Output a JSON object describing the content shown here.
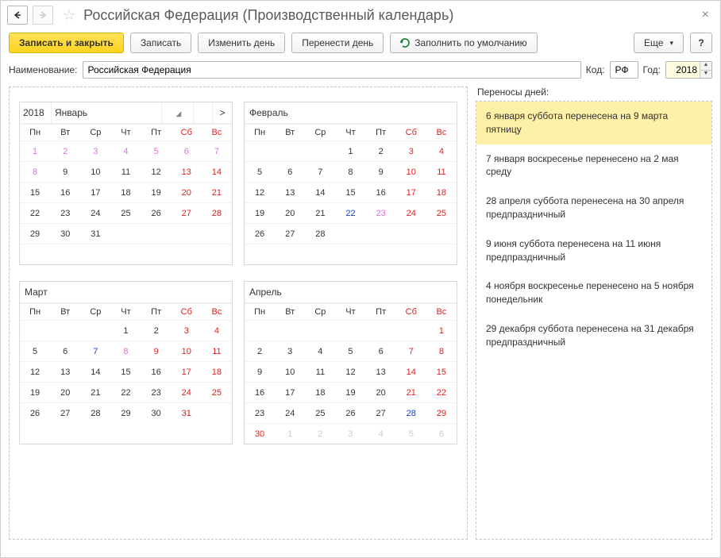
{
  "title": "Российская Федерация (Производственный календарь)",
  "toolbar": {
    "save_close": "Записать и закрыть",
    "save": "Записать",
    "change_day": "Изменить день",
    "move_day": "Перенести день",
    "fill_default": "Заполнить по умолчанию",
    "more": "Еще",
    "help": "?"
  },
  "form": {
    "name_label": "Наименование:",
    "name_value": "Российская Федерация",
    "code_label": "Код:",
    "code_value": "РФ",
    "year_label": "Год:",
    "year_value": "2018"
  },
  "cal": {
    "year": "2018",
    "dow": [
      "Пн",
      "Вт",
      "Ср",
      "Чт",
      "Пт",
      "Сб",
      "Вс"
    ],
    "months": [
      {
        "name": "Январь",
        "show_year": true,
        "show_nav": true,
        "weeks": [
          [
            {
              "d": "1",
              "c": "holiday"
            },
            {
              "d": "2",
              "c": "holiday"
            },
            {
              "d": "3",
              "c": "holiday"
            },
            {
              "d": "4",
              "c": "holiday"
            },
            {
              "d": "5",
              "c": "holiday"
            },
            {
              "d": "6",
              "c": "holiday"
            },
            {
              "d": "7",
              "c": "holiday"
            }
          ],
          [
            {
              "d": "8",
              "c": "holiday"
            },
            {
              "d": "9"
            },
            {
              "d": "10"
            },
            {
              "d": "11"
            },
            {
              "d": "12"
            },
            {
              "d": "13",
              "c": "weekend"
            },
            {
              "d": "14",
              "c": "weekend"
            }
          ],
          [
            {
              "d": "15"
            },
            {
              "d": "16"
            },
            {
              "d": "17"
            },
            {
              "d": "18"
            },
            {
              "d": "19"
            },
            {
              "d": "20",
              "c": "weekend"
            },
            {
              "d": "21",
              "c": "weekend"
            }
          ],
          [
            {
              "d": "22"
            },
            {
              "d": "23"
            },
            {
              "d": "24"
            },
            {
              "d": "25"
            },
            {
              "d": "26"
            },
            {
              "d": "27",
              "c": "weekend"
            },
            {
              "d": "28",
              "c": "weekend"
            }
          ],
          [
            {
              "d": "29"
            },
            {
              "d": "30"
            },
            {
              "d": "31"
            },
            {
              "d": ""
            },
            {
              "d": ""
            },
            {
              "d": ""
            },
            {
              "d": ""
            }
          ],
          [
            {
              "d": ""
            },
            {
              "d": ""
            },
            {
              "d": ""
            },
            {
              "d": ""
            },
            {
              "d": ""
            },
            {
              "d": ""
            },
            {
              "d": ""
            }
          ]
        ]
      },
      {
        "name": "Февраль",
        "weeks": [
          [
            {
              "d": ""
            },
            {
              "d": ""
            },
            {
              "d": ""
            },
            {
              "d": "1"
            },
            {
              "d": "2"
            },
            {
              "d": "3",
              "c": "weekend"
            },
            {
              "d": "4",
              "c": "weekend"
            }
          ],
          [
            {
              "d": "5"
            },
            {
              "d": "6"
            },
            {
              "d": "7"
            },
            {
              "d": "8"
            },
            {
              "d": "9"
            },
            {
              "d": "10",
              "c": "weekend"
            },
            {
              "d": "11",
              "c": "weekend"
            }
          ],
          [
            {
              "d": "12"
            },
            {
              "d": "13"
            },
            {
              "d": "14"
            },
            {
              "d": "15"
            },
            {
              "d": "16"
            },
            {
              "d": "17",
              "c": "weekend"
            },
            {
              "d": "18",
              "c": "weekend"
            }
          ],
          [
            {
              "d": "19"
            },
            {
              "d": "20"
            },
            {
              "d": "21"
            },
            {
              "d": "22",
              "c": "preholiday"
            },
            {
              "d": "23",
              "c": "holiday"
            },
            {
              "d": "24",
              "c": "weekend"
            },
            {
              "d": "25",
              "c": "weekend"
            }
          ],
          [
            {
              "d": "26"
            },
            {
              "d": "27"
            },
            {
              "d": "28"
            },
            {
              "d": ""
            },
            {
              "d": ""
            },
            {
              "d": ""
            },
            {
              "d": ""
            }
          ],
          [
            {
              "d": ""
            },
            {
              "d": ""
            },
            {
              "d": ""
            },
            {
              "d": ""
            },
            {
              "d": ""
            },
            {
              "d": ""
            },
            {
              "d": ""
            }
          ]
        ]
      },
      {
        "name": "Март",
        "weeks": [
          [
            {
              "d": ""
            },
            {
              "d": ""
            },
            {
              "d": ""
            },
            {
              "d": "1"
            },
            {
              "d": "2"
            },
            {
              "d": "3",
              "c": "weekend"
            },
            {
              "d": "4",
              "c": "weekend"
            }
          ],
          [
            {
              "d": "5"
            },
            {
              "d": "6"
            },
            {
              "d": "7",
              "c": "preholiday"
            },
            {
              "d": "8",
              "c": "holiday"
            },
            {
              "d": "9",
              "c": "weekend"
            },
            {
              "d": "10",
              "c": "weekend"
            },
            {
              "d": "11",
              "c": "weekend"
            }
          ],
          [
            {
              "d": "12"
            },
            {
              "d": "13"
            },
            {
              "d": "14"
            },
            {
              "d": "15"
            },
            {
              "d": "16"
            },
            {
              "d": "17",
              "c": "weekend"
            },
            {
              "d": "18",
              "c": "weekend"
            }
          ],
          [
            {
              "d": "19"
            },
            {
              "d": "20"
            },
            {
              "d": "21"
            },
            {
              "d": "22"
            },
            {
              "d": "23"
            },
            {
              "d": "24",
              "c": "weekend"
            },
            {
              "d": "25",
              "c": "weekend"
            }
          ],
          [
            {
              "d": "26"
            },
            {
              "d": "27"
            },
            {
              "d": "28"
            },
            {
              "d": "29"
            },
            {
              "d": "30"
            },
            {
              "d": "31",
              "c": "weekend"
            },
            {
              "d": ""
            }
          ]
        ]
      },
      {
        "name": "Апрель",
        "weeks": [
          [
            {
              "d": ""
            },
            {
              "d": ""
            },
            {
              "d": ""
            },
            {
              "d": ""
            },
            {
              "d": ""
            },
            {
              "d": ""
            },
            {
              "d": "1",
              "c": "weekend"
            }
          ],
          [
            {
              "d": "2"
            },
            {
              "d": "3"
            },
            {
              "d": "4"
            },
            {
              "d": "5"
            },
            {
              "d": "6"
            },
            {
              "d": "7",
              "c": "weekend"
            },
            {
              "d": "8",
              "c": "weekend"
            }
          ],
          [
            {
              "d": "9"
            },
            {
              "d": "10"
            },
            {
              "d": "11"
            },
            {
              "d": "12"
            },
            {
              "d": "13"
            },
            {
              "d": "14",
              "c": "weekend"
            },
            {
              "d": "15",
              "c": "weekend"
            }
          ],
          [
            {
              "d": "16"
            },
            {
              "d": "17"
            },
            {
              "d": "18"
            },
            {
              "d": "19"
            },
            {
              "d": "20"
            },
            {
              "d": "21",
              "c": "weekend"
            },
            {
              "d": "22",
              "c": "weekend"
            }
          ],
          [
            {
              "d": "23"
            },
            {
              "d": "24"
            },
            {
              "d": "25"
            },
            {
              "d": "26"
            },
            {
              "d": "27"
            },
            {
              "d": "28",
              "c": "preholiday"
            },
            {
              "d": "29",
              "c": "weekend"
            }
          ],
          [
            {
              "d": "30",
              "c": "weekend"
            },
            {
              "d": "1",
              "c": "muted"
            },
            {
              "d": "2",
              "c": "muted"
            },
            {
              "d": "3",
              "c": "muted"
            },
            {
              "d": "4",
              "c": "muted"
            },
            {
              "d": "5",
              "c": "muted"
            },
            {
              "d": "6",
              "c": "muted"
            }
          ]
        ]
      }
    ]
  },
  "moves": {
    "label": "Переносы дней:",
    "items": [
      {
        "text": "6 января суббота перенесена на 9 марта пятницу",
        "selected": true
      },
      {
        "text": "7 января воскресенье перенесено на 2 мая среду"
      },
      {
        "text": "28 апреля суббота перенесена на 30 апреля предпраздничный"
      },
      {
        "text": "9 июня суббота перенесена на 11 июня предпраздничный"
      },
      {
        "text": "4 ноября воскресенье перенесено на 5 ноября понедельник"
      },
      {
        "text": "29 декабря суббота перенесена на 31 декабря предпраздничный"
      }
    ]
  }
}
